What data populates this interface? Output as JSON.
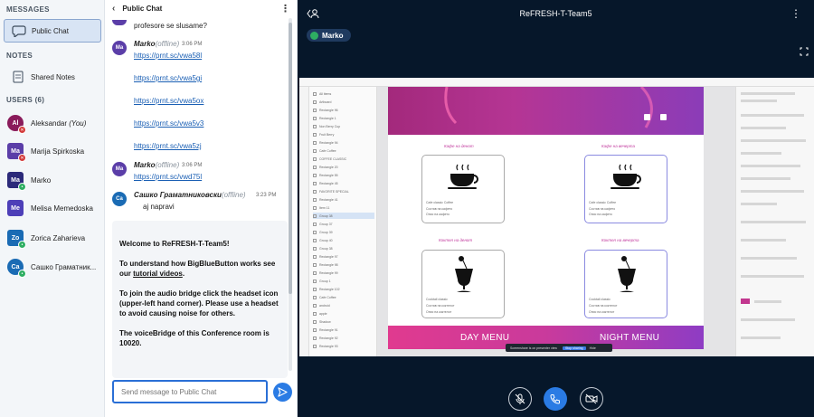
{
  "sidebar": {
    "messages_title": "MESSAGES",
    "public_chat_label": "Public Chat",
    "notes_title": "NOTES",
    "shared_notes_label": "Shared Notes",
    "users_title": "USERS (6)",
    "users": [
      {
        "initials": "Al",
        "name": "Aleksandar",
        "suffix": "(You)",
        "color": "#8a1b5b"
      },
      {
        "initials": "Ma",
        "name": "Marija Spirkoska",
        "color": "#5b3ea8"
      },
      {
        "initials": "Ma",
        "name": "Marko",
        "color": "#5b3ea8"
      },
      {
        "initials": "Me",
        "name": "Melisa Memedoska",
        "color": "#4d3fb8"
      },
      {
        "initials": "Zo",
        "name": "Zorica Zaharieva",
        "color": "#1a6bb4"
      },
      {
        "initials": "Са",
        "name": "Сашко Граматник...",
        "color": "#1a6bb4"
      }
    ]
  },
  "chat": {
    "title": "Public Chat",
    "partial_message": "profesore se slusame?",
    "messages": [
      {
        "initials": "Ma",
        "name": "Marko",
        "status": "(offline)",
        "time": "3:06 PM",
        "links": [
          "https://prnt.sc/vwa58l",
          "https://prnt.sc/vwa5gi",
          "https://prnt.sc/vwa5ox",
          "https://prnt.sc/vwa5v3",
          "https://prnt.sc/vwa5zj"
        ]
      },
      {
        "initials": "Ma",
        "name": "Marko",
        "status": "(offline)",
        "time": "3:06 PM",
        "links": [
          "https://prnt.sc/vwd75l"
        ]
      },
      {
        "initials": "Са",
        "name": "Сашко Граматниковски",
        "status": "(offline)",
        "time": "3:23 PM",
        "text": "aj napravi"
      }
    ],
    "welcome": {
      "line1": "Welcome to ReFRESH-T-Team5!",
      "line2a": "To understand how BigBlueButton works see our",
      "line2link": "tutorial videos",
      "line2b": ".",
      "line3a": "To join the audio bridge click the headset icon (upper-left hand corner).",
      "line3b": "Please use a headset to avoid causing noise for others.",
      "line4": "The voiceBridge of this Conference room is 10020."
    },
    "input_placeholder": "Send message to Public Chat"
  },
  "main": {
    "title": "ReFRESH-T-Team5",
    "presenter": "Marko",
    "screen": {
      "day_menu": "DAY MENU",
      "night_menu": "NIGHT MENU",
      "toast_text": "Screenshare is on presenter view",
      "toast_button": "Stop sharing",
      "toast_hide": "Hide"
    }
  },
  "colors": {
    "accent_blue": "#2a7be4",
    "main_bg": "#06172a",
    "presenter_green": "#2eae62"
  }
}
